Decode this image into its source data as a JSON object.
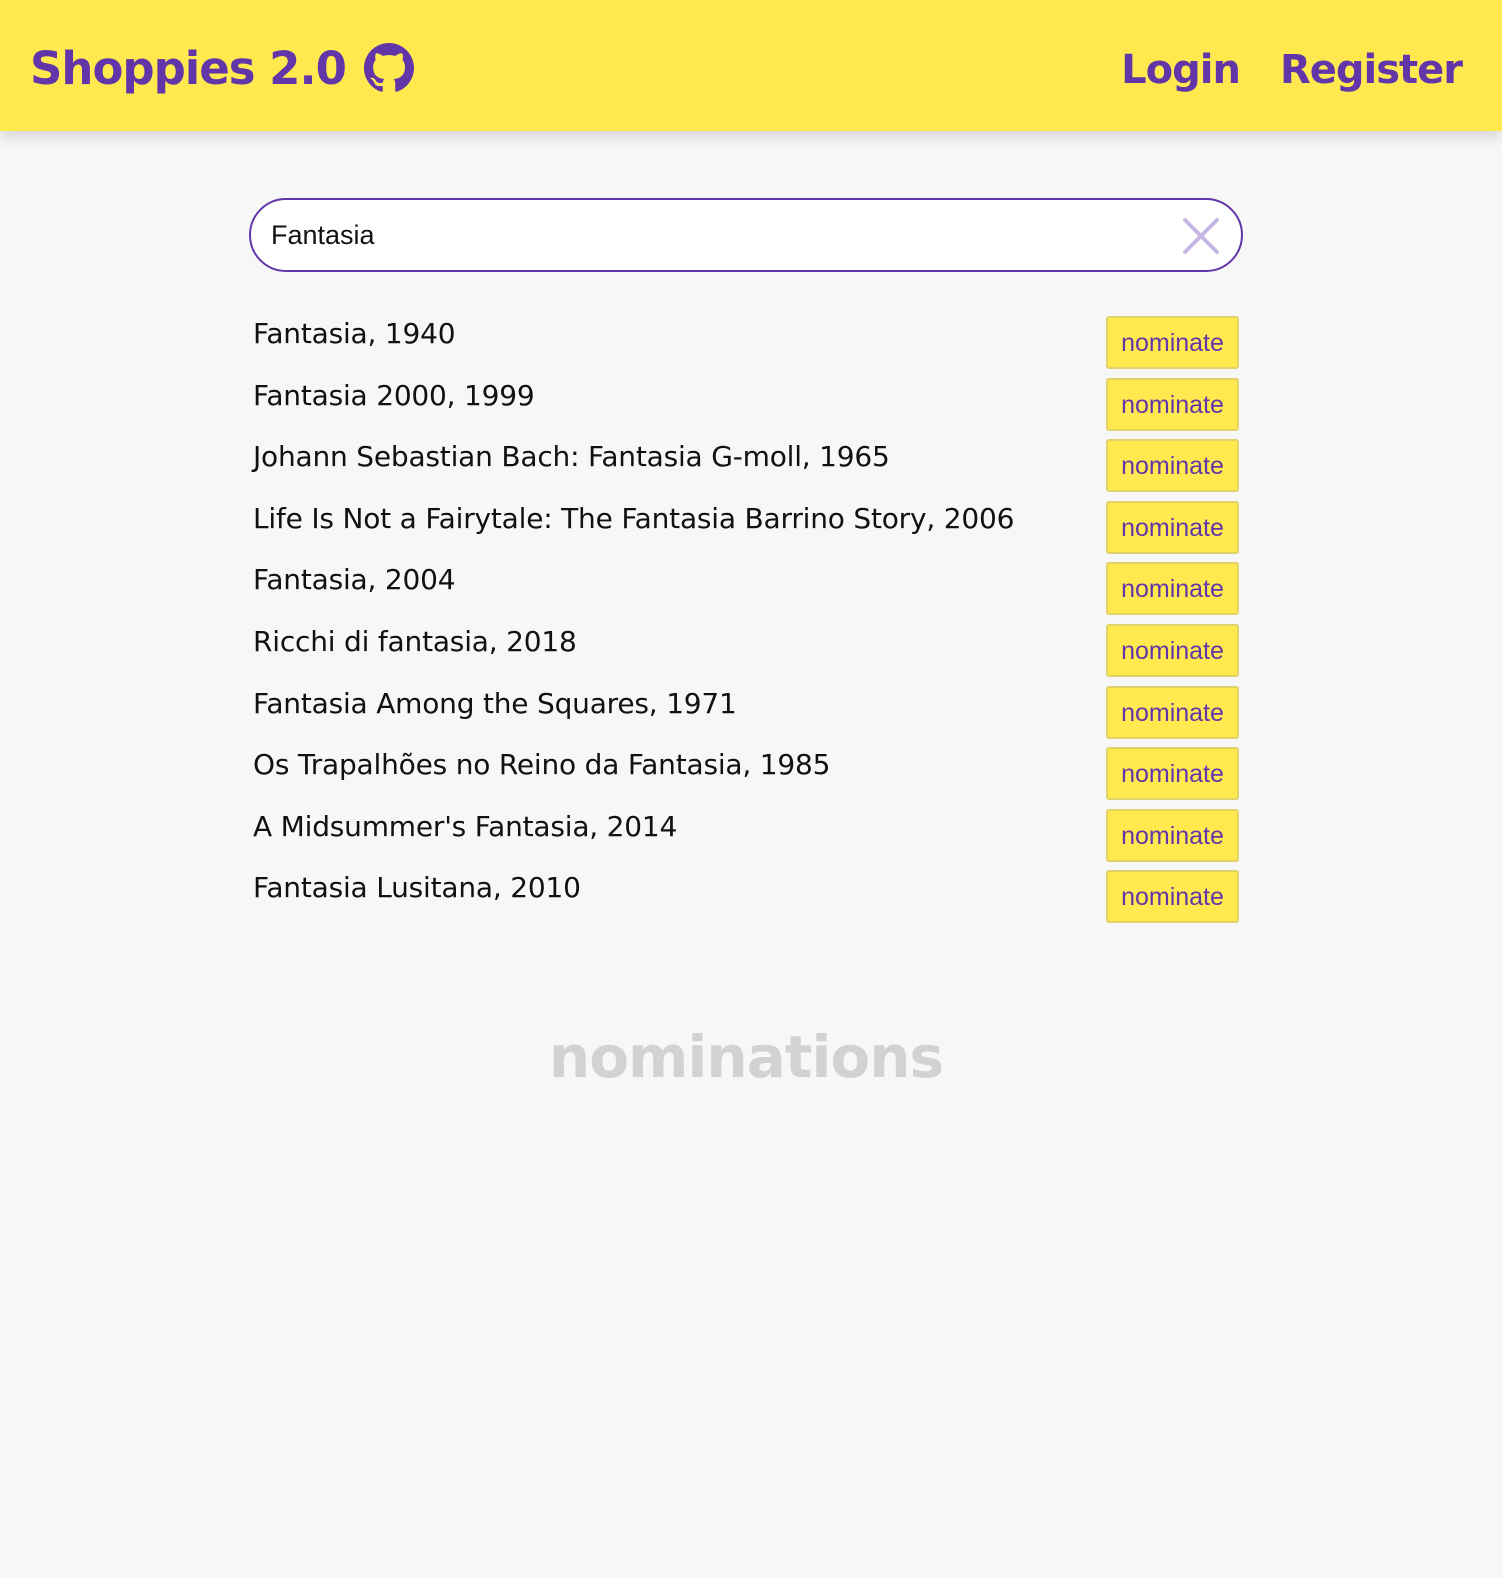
{
  "header": {
    "brand": "Shoppies 2.0",
    "github_icon": "github-icon",
    "login_label": "Login",
    "register_label": "Register"
  },
  "colors": {
    "accent": "#6236a8",
    "header_bg": "#ffe94f",
    "page_bg": "#f8f7f8",
    "muted_heading": "#d3d2d3"
  },
  "search": {
    "value": "Fantasia",
    "clear_icon": "close-icon"
  },
  "results": [
    {
      "title": "Fantasia, 1940",
      "action": "nominate"
    },
    {
      "title": "Fantasia 2000, 1999",
      "action": "nominate"
    },
    {
      "title": "Johann Sebastian Bach: Fantasia G-moll, 1965",
      "action": "nominate"
    },
    {
      "title": "Life Is Not a Fairytale: The Fantasia Barrino Story, 2006",
      "action": "nominate"
    },
    {
      "title": "Fantasia, 2004",
      "action": "nominate"
    },
    {
      "title": "Ricchi di fantasia, 2018",
      "action": "nominate"
    },
    {
      "title": "Fantasia Among the Squares, 1971",
      "action": "nominate"
    },
    {
      "title": "Os Trapalhões no Reino da Fantasia, 1985",
      "action": "nominate"
    },
    {
      "title": "A Midsummer's Fantasia, 2014",
      "action": "nominate"
    },
    {
      "title": "Fantasia Lusitana, 2010",
      "action": "nominate"
    }
  ],
  "nominations": {
    "heading": "nominations"
  }
}
